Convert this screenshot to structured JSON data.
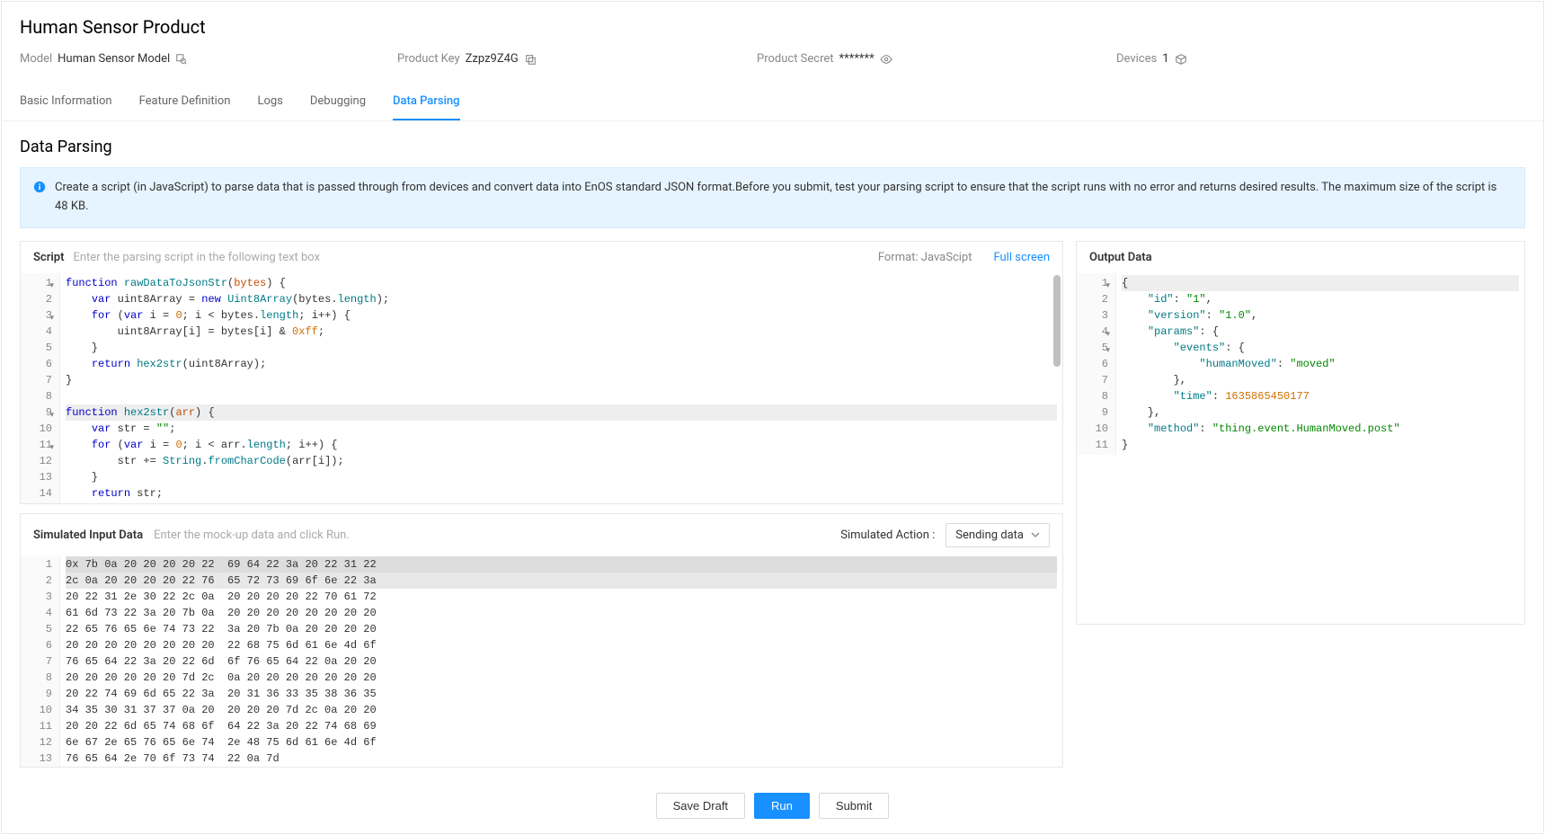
{
  "header": {
    "title": "Human Sensor Product",
    "model_label": "Model",
    "model_value": "Human Sensor Model",
    "product_key_label": "Product Key",
    "product_key_value": "Zzpz9Z4G",
    "product_secret_label": "Product Secret",
    "product_secret_value": "*******",
    "devices_label": "Devices",
    "devices_count": "1"
  },
  "tabs": [
    "Basic Information",
    "Feature Definition",
    "Logs",
    "Debugging",
    "Data Parsing"
  ],
  "active_tab": 4,
  "section_title": "Data Parsing",
  "alert_text": "Create a script (in JavaScript) to parse data that is passed through from devices and convert data into EnOS standard JSON format.Before you submit, test your parsing script to ensure that the script runs with no error and returns desired results. The maximum size of the script is 48 KB.",
  "script_panel": {
    "title": "Script",
    "hint": "Enter the parsing script in the following text box",
    "format_label": "Format: JavaScipt",
    "fullscreen": "Full screen",
    "lines": [
      {
        "n": 1,
        "fold": true,
        "html": "<span class='kw'>function</span> <span class='fn'>rawDataToJsonStr</span>(<span class='var'>bytes</span>) {"
      },
      {
        "n": 2,
        "html": "    <span class='kw'>var</span> uint8Array = <span class='kw'>new</span> <span class='fn'>Uint8Array</span>(bytes.<span class='prop'>length</span>);"
      },
      {
        "n": 3,
        "fold": true,
        "html": "    <span class='kw'>for</span> (<span class='kw'>var</span> i = <span class='num'>0</span>; i &lt; bytes.<span class='prop'>length</span>; i++) {"
      },
      {
        "n": 4,
        "html": "        uint8Array[i] = bytes[i] &amp; <span class='num'>0xff</span>;"
      },
      {
        "n": 5,
        "html": "    }"
      },
      {
        "n": 6,
        "html": "    <span class='kw'>return</span> <span class='fn'>hex2str</span>(uint8Array);"
      },
      {
        "n": 7,
        "html": "}"
      },
      {
        "n": 8,
        "html": ""
      },
      {
        "n": 9,
        "fold": true,
        "hl": true,
        "html": "<span class='kw'>function</span> <span class='fn'>hex2str</span>(<span class='var'>arr</span>) {"
      },
      {
        "n": 10,
        "html": "    <span class='kw'>var</span> str = <span class='str'>\"\"</span>;"
      },
      {
        "n": 11,
        "fold": true,
        "html": "    <span class='kw'>for</span> (<span class='kw'>var</span> i = <span class='num'>0</span>; i &lt; arr.<span class='prop'>length</span>; i++) {"
      },
      {
        "n": 12,
        "html": "        str += <span class='fn'>String</span>.<span class='fn'>fromCharCode</span>(arr[i]);"
      },
      {
        "n": 13,
        "html": "    }"
      },
      {
        "n": 14,
        "html": "    <span class='kw'>return</span> str;"
      }
    ]
  },
  "sim_panel": {
    "title": "Simulated Input Data",
    "hint": "Enter the mock-up data and click Run.",
    "action_label": "Simulated Action :",
    "action_value": "Sending data",
    "hex_lines": [
      {
        "n": 1,
        "hl": 1,
        "t": "0x 7b 0a 20 20 20 20 22  69 64 22 3a 20 22 31 22"
      },
      {
        "n": 2,
        "hl": 2,
        "t": "2c 0a 20 20 20 20 22 76  65 72 73 69 6f 6e 22 3a"
      },
      {
        "n": 3,
        "t": "20 22 31 2e 30 22 2c 0a  20 20 20 20 22 70 61 72"
      },
      {
        "n": 4,
        "t": "61 6d 73 22 3a 20 7b 0a  20 20 20 20 20 20 20 20"
      },
      {
        "n": 5,
        "t": "22 65 76 65 6e 74 73 22  3a 20 7b 0a 20 20 20 20"
      },
      {
        "n": 6,
        "t": "20 20 20 20 20 20 20 20  22 68 75 6d 61 6e 4d 6f"
      },
      {
        "n": 7,
        "t": "76 65 64 22 3a 20 22 6d  6f 76 65 64 22 0a 20 20"
      },
      {
        "n": 8,
        "t": "20 20 20 20 20 20 7d 2c  0a 20 20 20 20 20 20 20"
      },
      {
        "n": 9,
        "t": "20 22 74 69 6d 65 22 3a  20 31 36 33 35 38 36 35"
      },
      {
        "n": 10,
        "t": "34 35 30 31 37 37 0a 20  20 20 20 7d 2c 0a 20 20"
      },
      {
        "n": 11,
        "t": "20 20 22 6d 65 74 68 6f  64 22 3a 20 22 74 68 69"
      },
      {
        "n": 12,
        "t": "6e 67 2e 65 76 65 6e 74  2e 48 75 6d 61 6e 4d 6f"
      },
      {
        "n": 13,
        "t": "76 65 64 2e 70 6f 73 74  22 0a 7d"
      }
    ]
  },
  "output_panel": {
    "title": "Output Data",
    "lines": [
      {
        "n": 1,
        "fold": true,
        "hl": true,
        "html": "{"
      },
      {
        "n": 2,
        "html": "    <span class='json-key'>\"id\"</span>: <span class='json-str'>\"1\"</span>,"
      },
      {
        "n": 3,
        "html": "    <span class='json-key'>\"version\"</span>: <span class='json-str'>\"1.0\"</span>,"
      },
      {
        "n": 4,
        "fold": true,
        "html": "    <span class='json-key'>\"params\"</span>: {"
      },
      {
        "n": 5,
        "fold": true,
        "html": "        <span class='json-key'>\"events\"</span>: {"
      },
      {
        "n": 6,
        "html": "            <span class='json-key'>\"humanMoved\"</span>: <span class='json-str'>\"moved\"</span>"
      },
      {
        "n": 7,
        "html": "        },"
      },
      {
        "n": 8,
        "html": "        <span class='json-key'>\"time\"</span>: <span class='json-num'>1635865450177</span>"
      },
      {
        "n": 9,
        "html": "    },"
      },
      {
        "n": 10,
        "html": "    <span class='json-key'>\"method\"</span>: <span class='json-str'>\"thing.event.HumanMoved.post\"</span>"
      },
      {
        "n": 11,
        "html": "}"
      }
    ]
  },
  "footer": {
    "save_draft": "Save Draft",
    "run": "Run",
    "submit": "Submit"
  }
}
